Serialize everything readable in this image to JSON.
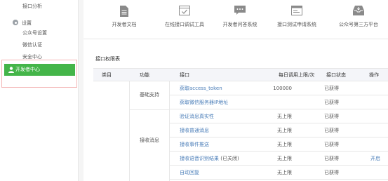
{
  "sidebar": {
    "api_analysis": "接口分析",
    "settings_group": "设置",
    "items": [
      {
        "label": "公众号设置"
      },
      {
        "label": "微信认证"
      },
      {
        "label": "安全中心"
      }
    ],
    "developer_center": "开发者中心"
  },
  "tools": [
    {
      "label": "开发者文档",
      "icon": "document-icon"
    },
    {
      "label": "在线接口调试工具",
      "icon": "debug-tool-icon"
    },
    {
      "label": "开发者问答系统",
      "icon": "chat-bubble-icon"
    },
    {
      "label": "接口测试申请系统",
      "icon": "window-icon"
    },
    {
      "label": "公众号第三方平台",
      "icon": "inbox-icon"
    }
  ],
  "permissions": {
    "title": "接口权限表",
    "headers": {
      "category": "类目",
      "function": "功能",
      "api": "接口",
      "daily_limit": "每日调用上限/次",
      "status": "接口状态",
      "action": "操作"
    },
    "groups": [
      {
        "name": "基础支持"
      },
      {
        "name": "接收消息"
      }
    ],
    "rows": [
      {
        "api": "获取access_token",
        "note": "",
        "limit": "100000",
        "status": "已获得",
        "action": ""
      },
      {
        "api": "获取微信服务器IP地址",
        "note": "",
        "limit": "",
        "status": "已获得",
        "action": ""
      },
      {
        "api": "验证消息真实性",
        "note": "",
        "limit": "无上限",
        "status": "已获得",
        "action": ""
      },
      {
        "api": "接收普通消息",
        "note": "",
        "limit": "无上限",
        "status": "已获得",
        "action": ""
      },
      {
        "api": "接收事件推送",
        "note": "",
        "limit": "无上限",
        "status": "已获得",
        "action": ""
      },
      {
        "api": "接收语音识别结果",
        "note": "(已关闭)",
        "limit": "无上限",
        "status": "已获得",
        "action": "开启"
      },
      {
        "api": "自动回复",
        "note": "",
        "limit": "无上限",
        "status": "已获得",
        "action": ""
      }
    ]
  },
  "colors": {
    "accent_green": "#44b549",
    "link_blue": "#4a7db8",
    "highlight_border": "#f4b6b6"
  }
}
